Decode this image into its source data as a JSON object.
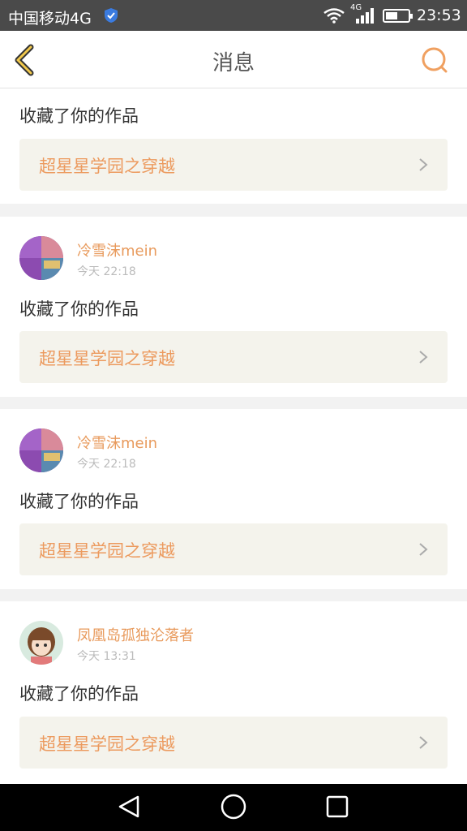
{
  "status_bar": {
    "carrier": "中国移动4G",
    "network_type": "4G",
    "time": "23:53",
    "battery_level": 0.55,
    "icons": [
      "shield-icon",
      "wifi-icon",
      "signal-icon",
      "battery-icon"
    ]
  },
  "header": {
    "title": "消息",
    "back_icon": "chevron-left-icon",
    "search_icon": "search-icon",
    "accent_color": "#e8a341"
  },
  "messages": [
    {
      "user": "",
      "time": "",
      "action": "收藏了你的作品",
      "work_title": "超星星学园之穿越"
    },
    {
      "user": "冷雪沫mein",
      "time": "今天 22:18",
      "action": "收藏了你的作品",
      "work_title": "超星星学园之穿越"
    },
    {
      "user": "冷雪沫mein",
      "time": "今天 22:18",
      "action": "收藏了你的作品",
      "work_title": "超星星学园之穿越"
    },
    {
      "user": "凤凰岛孤独沦落者",
      "time": "今天 13:31",
      "action": "收藏了你的作品",
      "work_title": "超星星学园之穿越"
    }
  ],
  "colors": {
    "username": "#e89a5c",
    "work_title": "#ec9a5e",
    "work_bg": "#f4f3ec"
  },
  "nav_bar": {
    "icons": [
      "nav-back-icon",
      "nav-home-icon",
      "nav-recent-icon"
    ]
  }
}
